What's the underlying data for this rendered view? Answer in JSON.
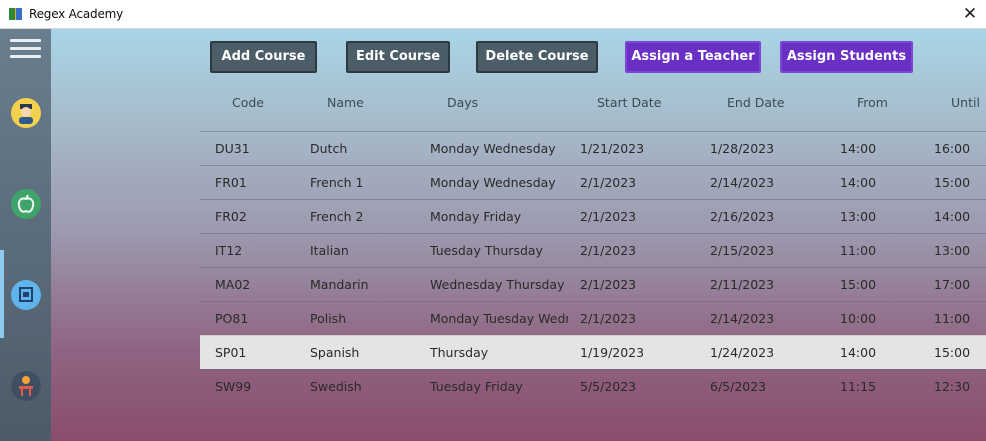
{
  "window": {
    "title": "Regex Academy",
    "close_glyph": "✕"
  },
  "sidebar": {
    "menu_icon": "hamburger-menu-icon",
    "items": [
      {
        "icon": "teacher-avatar-icon",
        "color": "#f3d04e"
      },
      {
        "icon": "apple-icon",
        "color": "#3fa36a"
      },
      {
        "icon": "picture-frame-icon",
        "color": "#5fb4ea",
        "active": true
      },
      {
        "icon": "student-desk-icon",
        "color": "#3f4f63"
      }
    ]
  },
  "toolbar": {
    "add": "Add Course",
    "edit": "Edit Course",
    "delete": "Delete Course",
    "assign_teacher": "Assign a Teacher",
    "assign_students": "Assign Students"
  },
  "table": {
    "columns": [
      "Code",
      "Name",
      "Days",
      "Start Date",
      "End Date",
      "From",
      "Until"
    ],
    "rows": [
      {
        "code": "DU31",
        "name": "Dutch",
        "days": "Monday Wednesday",
        "start": "1/21/2023",
        "end": "1/28/2023",
        "from": "14:00",
        "until": "16:00"
      },
      {
        "code": "FR01",
        "name": "French 1",
        "days": "Monday Wednesday",
        "start": "2/1/2023",
        "end": "2/14/2023",
        "from": "14:00",
        "until": "15:00"
      },
      {
        "code": "FR02",
        "name": "French 2",
        "days": "Monday Friday",
        "start": "2/1/2023",
        "end": "2/16/2023",
        "from": "13:00",
        "until": "14:00"
      },
      {
        "code": "IT12",
        "name": "Italian",
        "days": "Tuesday Thursday",
        "start": "2/1/2023",
        "end": "2/15/2023",
        "from": "11:00",
        "until": "13:00"
      },
      {
        "code": "MA02",
        "name": "Mandarin",
        "days": "Wednesday Thursday",
        "start": "2/1/2023",
        "end": "2/11/2023",
        "from": "15:00",
        "until": "17:00"
      },
      {
        "code": "PO81",
        "name": "Polish",
        "days": "Monday Tuesday Wedne",
        "start": "2/1/2023",
        "end": "2/14/2023",
        "from": "10:00",
        "until": "11:00"
      },
      {
        "code": "SP01",
        "name": "Spanish",
        "days": "Thursday",
        "start": "1/19/2023",
        "end": "1/24/2023",
        "from": "14:00",
        "until": "15:00",
        "selected": true
      },
      {
        "code": "SW99",
        "name": "Swedish",
        "days": "Tuesday Friday",
        "start": "5/5/2023",
        "end": "6/5/2023",
        "from": "11:15",
        "until": "12:30"
      }
    ]
  }
}
